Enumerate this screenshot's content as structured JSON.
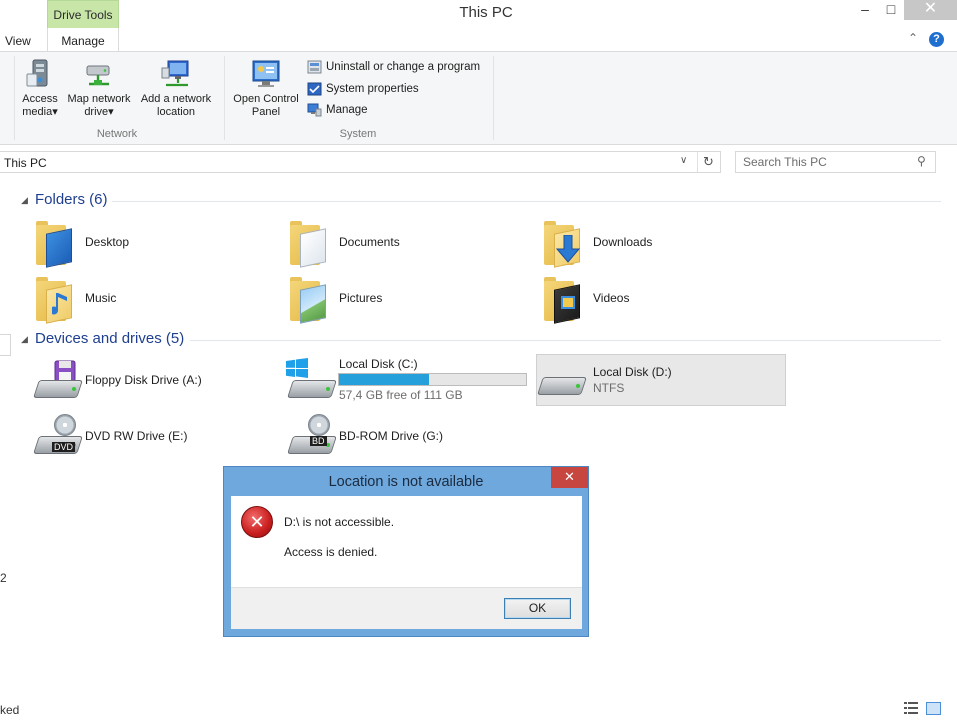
{
  "window": {
    "title": "This PC"
  },
  "window_controls": {
    "minimize": "–",
    "maximize": "□",
    "close": "✕"
  },
  "ribbon": {
    "context_tab": "Drive Tools",
    "tabs": {
      "view": "View",
      "manage": "Manage"
    },
    "buttons": {
      "access_media": {
        "line1": "Access",
        "line2": "media",
        "arrow": "▾"
      },
      "map_network_drive": {
        "line1": "Map network",
        "line2": "drive",
        "arrow": "▾"
      },
      "add_network_location": {
        "line1": "Add a network",
        "line2": "location"
      },
      "open_control_panel": {
        "line1": "Open Control",
        "line2": "Panel"
      }
    },
    "system_items": {
      "uninstall": "Uninstall or change a program",
      "system_properties": "System properties",
      "manage": "Manage"
    },
    "groups": {
      "network": "Network",
      "system": "System"
    }
  },
  "address": {
    "path": "This PC"
  },
  "search": {
    "placeholder": "Search This PC"
  },
  "nav_fragments": {
    "a": "2",
    "b": "ked"
  },
  "folders": {
    "header": "Folders (6)",
    "items": [
      "Desktop",
      "Documents",
      "Downloads",
      "Music",
      "Pictures",
      "Videos"
    ]
  },
  "drives": {
    "header": "Devices and drives (5)",
    "floppy": {
      "name": "Floppy Disk Drive (A:)"
    },
    "c": {
      "name": "Local Disk (C:)",
      "free": "57,4 GB free of 111 GB",
      "used_fraction": 0.483
    },
    "d": {
      "name": "Local Disk (D:)",
      "fs": "NTFS"
    },
    "dvd": {
      "name": "DVD RW Drive (E:)",
      "badge": "DVD"
    },
    "bd": {
      "name": "BD-ROM Drive (G:)",
      "badge": "BD"
    }
  },
  "dialog": {
    "title": "Location is not available",
    "close": "✕",
    "icon": "error-icon",
    "message1": "D:\\ is not accessible.",
    "message2": "Access is denied.",
    "ok": "OK"
  },
  "colors": {
    "accent": "#1e3f8f",
    "progress": "#26a0da",
    "dialog_frame": "#6fa8dc",
    "close_red": "#c7463f",
    "context_tab": "#c8e6a8"
  }
}
